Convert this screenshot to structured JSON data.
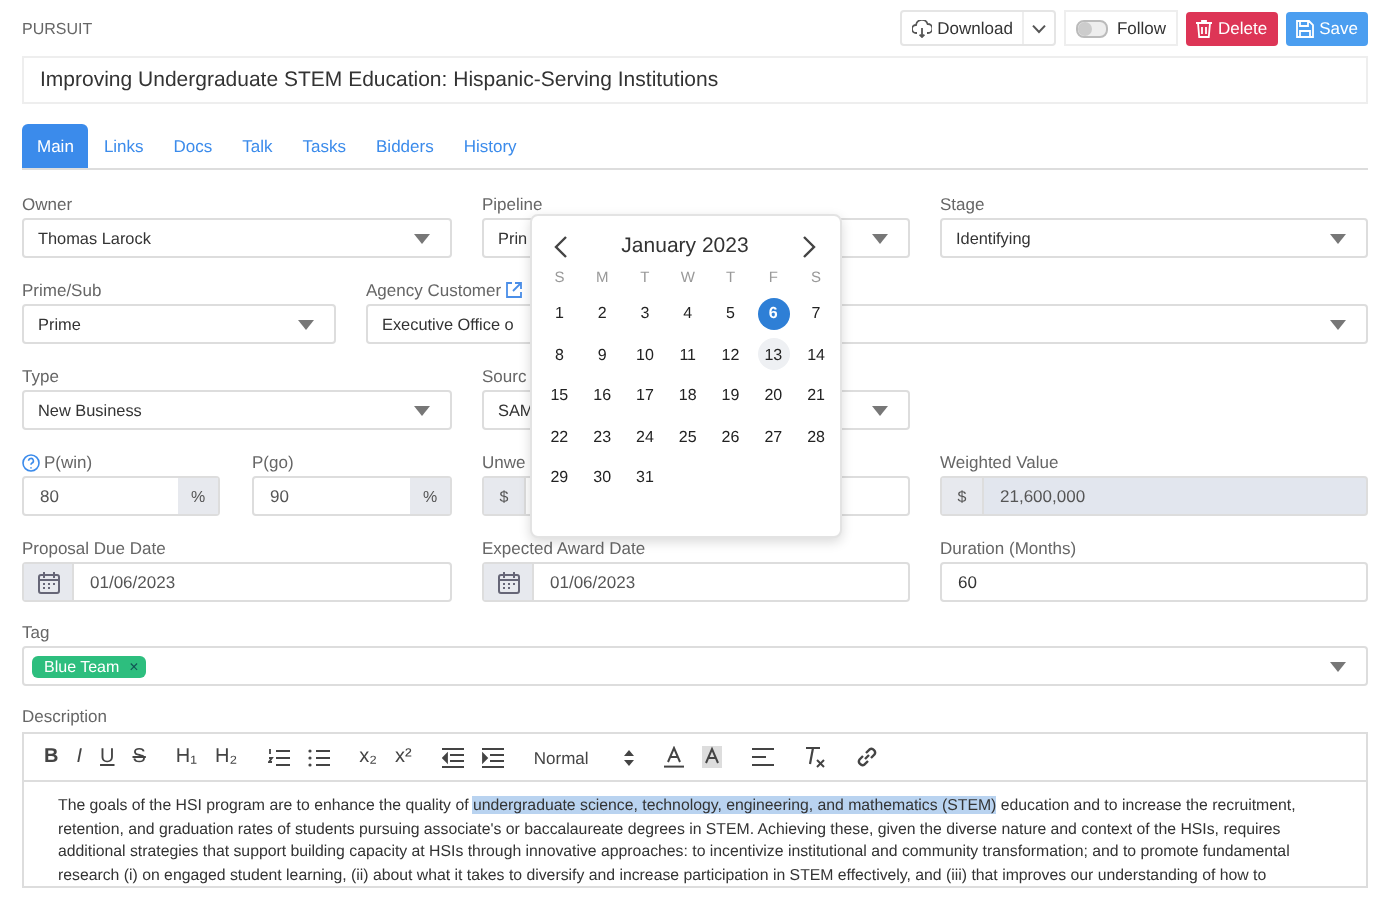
{
  "header": {
    "section": "PURSUIT",
    "download": "Download",
    "follow": {
      "label": "Follow",
      "on": false
    },
    "delete": "Delete",
    "save": "Save"
  },
  "title": "Improving Undergraduate STEM Education: Hispanic-Serving Institutions",
  "tabs": [
    {
      "label": "Main",
      "selected": true
    },
    {
      "label": "Links",
      "selected": false
    },
    {
      "label": "Docs",
      "selected": false
    },
    {
      "label": "Talk",
      "selected": false
    },
    {
      "label": "Tasks",
      "selected": false
    },
    {
      "label": "Bidders",
      "selected": false
    },
    {
      "label": "History",
      "selected": false
    }
  ],
  "owner": {
    "label": "Owner",
    "value": "Thomas Larock"
  },
  "pipeline": {
    "label": "Pipeline",
    "value": "Prin"
  },
  "stage": {
    "label": "Stage",
    "value": "Identifying"
  },
  "prime_sub": {
    "label": "Prime/Sub",
    "value": "Prime"
  },
  "agency_customer": {
    "label": "Agency Customer",
    "value": "Executive Office o"
  },
  "type": {
    "label": "Type",
    "value": "New Business"
  },
  "source": {
    "label": "Sourc",
    "value": "SAM"
  },
  "p_win": {
    "label": "P(win)",
    "value": "80",
    "unit": "%"
  },
  "p_go": {
    "label": "P(go)",
    "value": "90",
    "unit": "%"
  },
  "unweighted": {
    "label": "Unwe",
    "prefix": "$"
  },
  "weighted": {
    "label": "Weighted Value",
    "prefix": "$",
    "value": "21,600,000"
  },
  "proposal_due": {
    "label": "Proposal Due Date",
    "value": "01/06/2023"
  },
  "award_date": {
    "label": "Expected Award Date",
    "value": "01/06/2023"
  },
  "duration": {
    "label": "Duration (Months)",
    "value": "60"
  },
  "tag": {
    "label": "Tag",
    "tags": [
      {
        "label": "Blue Team",
        "remove": "×",
        "color": "#2dbe7e"
      }
    ]
  },
  "description": {
    "label": "Description",
    "format_buttons": [
      "B",
      "I",
      "U",
      "S",
      "H₁",
      "H₂"
    ],
    "script_buttons": [
      "x₂",
      "x²"
    ],
    "header_select": "Normal",
    "segments": [
      {
        "text": "The goals of the HSI program are to enhance the quality of ",
        "highlighted": false
      },
      {
        "text": "undergraduate science, technology, engineering, and mathematics (STEM)",
        "highlighted": true
      },
      {
        "text": " education and to increase the recruitment, retention, and graduation rates of students pursuing associate's or baccalaureate degrees in STEM. Achieving these, given the diverse nature and context of the HSIs, requires additional strategies that support building capacity at HSIs through innovative approaches: to incentivize institutional and community transformation; and to promote fundamental research (i) on engaged student learning, (ii) about what it takes to diversify and increase participation in STEM effectively, and (iii) that improves our understanding of how to",
        "highlighted": false
      }
    ]
  },
  "calendar": {
    "month": "January 2023",
    "weekdays": [
      "S",
      "M",
      "T",
      "W",
      "T",
      "F",
      "S"
    ],
    "days": [
      {
        "day": "1",
        "selected": false,
        "today": false
      },
      {
        "day": "2",
        "selected": false,
        "today": false
      },
      {
        "day": "3",
        "selected": false,
        "today": false
      },
      {
        "day": "4",
        "selected": false,
        "today": false
      },
      {
        "day": "5",
        "selected": false,
        "today": false
      },
      {
        "day": "6",
        "selected": true,
        "today": false
      },
      {
        "day": "7",
        "selected": false,
        "today": false
      },
      {
        "day": "8",
        "selected": false,
        "today": false
      },
      {
        "day": "9",
        "selected": false,
        "today": false
      },
      {
        "day": "10",
        "selected": false,
        "today": false
      },
      {
        "day": "11",
        "selected": false,
        "today": false
      },
      {
        "day": "12",
        "selected": false,
        "today": false
      },
      {
        "day": "13",
        "selected": false,
        "today": true
      },
      {
        "day": "14",
        "selected": false,
        "today": false
      },
      {
        "day": "15",
        "selected": false,
        "today": false
      },
      {
        "day": "16",
        "selected": false,
        "today": false
      },
      {
        "day": "17",
        "selected": false,
        "today": false
      },
      {
        "day": "18",
        "selected": false,
        "today": false
      },
      {
        "day": "19",
        "selected": false,
        "today": false
      },
      {
        "day": "20",
        "selected": false,
        "today": false
      },
      {
        "day": "21",
        "selected": false,
        "today": false
      },
      {
        "day": "22",
        "selected": false,
        "today": false
      },
      {
        "day": "23",
        "selected": false,
        "today": false
      },
      {
        "day": "24",
        "selected": false,
        "today": false
      },
      {
        "day": "25",
        "selected": false,
        "today": false
      },
      {
        "day": "26",
        "selected": false,
        "today": false
      },
      {
        "day": "27",
        "selected": false,
        "today": false
      },
      {
        "day": "28",
        "selected": false,
        "today": false
      },
      {
        "day": "29",
        "selected": false,
        "today": false
      },
      {
        "day": "30",
        "selected": false,
        "today": false
      },
      {
        "day": "31",
        "selected": false,
        "today": false
      }
    ]
  }
}
